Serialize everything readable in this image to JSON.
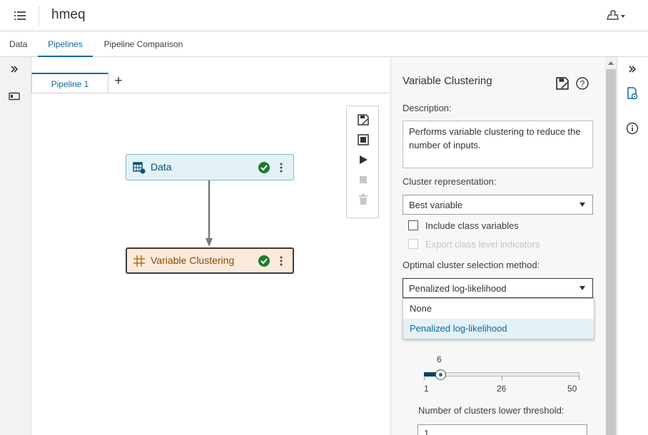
{
  "app": {
    "title": "hmeq"
  },
  "tabs": [
    {
      "label": "Data"
    },
    {
      "label": "Pipelines"
    },
    {
      "label": "Pipeline Comparison"
    }
  ],
  "pipeline": {
    "tab_label": "Pipeline 1",
    "add_tab_symbol": "+",
    "nodes": [
      {
        "label": "Data",
        "status": "complete"
      },
      {
        "label": "Variable Clustering",
        "status": "complete"
      }
    ]
  },
  "panel": {
    "title": "Variable Clustering",
    "description_label": "Description:",
    "description_value": "Performs variable clustering to reduce the number of inputs.",
    "cluster_representation_label": "Cluster representation:",
    "cluster_representation_value": "Best variable",
    "include_class_label": "Include class variables",
    "export_class_label": "Export class level indicators",
    "optimal_method_label": "Optimal cluster selection method:",
    "optimal_method_value": "Penalized log-likelihood",
    "optimal_method_options": [
      "None",
      "Penalized log-likelihood"
    ],
    "slider": {
      "value": "6",
      "min_label": "1",
      "mid_label": "26",
      "max_label": "50",
      "min": 1,
      "max": 50,
      "current": 6
    },
    "lower_threshold_label": "Number of clusters lower threshold:",
    "lower_threshold_value": "1"
  },
  "colors": {
    "accent": "#0b6a9e",
    "data_node_bg": "#e3f2f6",
    "data_node_border": "#7fb6c7",
    "vc_node_bg": "#fbeadb",
    "vc_node_text": "#8a4a06",
    "status_ok": "#1e7a32"
  },
  "icons": {
    "menu": "list-menu-icon",
    "user": "user-dropdown-icon",
    "expand_left": "double-chevron-right-icon",
    "left_rail": "panel-toggle-icon",
    "expand_right": "double-chevron-right-icon",
    "properties": "node-properties-icon",
    "info": "info-icon",
    "toolbar": [
      "save-icon",
      "select-all-icon",
      "run-icon",
      "stop-icon",
      "delete-icon"
    ]
  }
}
